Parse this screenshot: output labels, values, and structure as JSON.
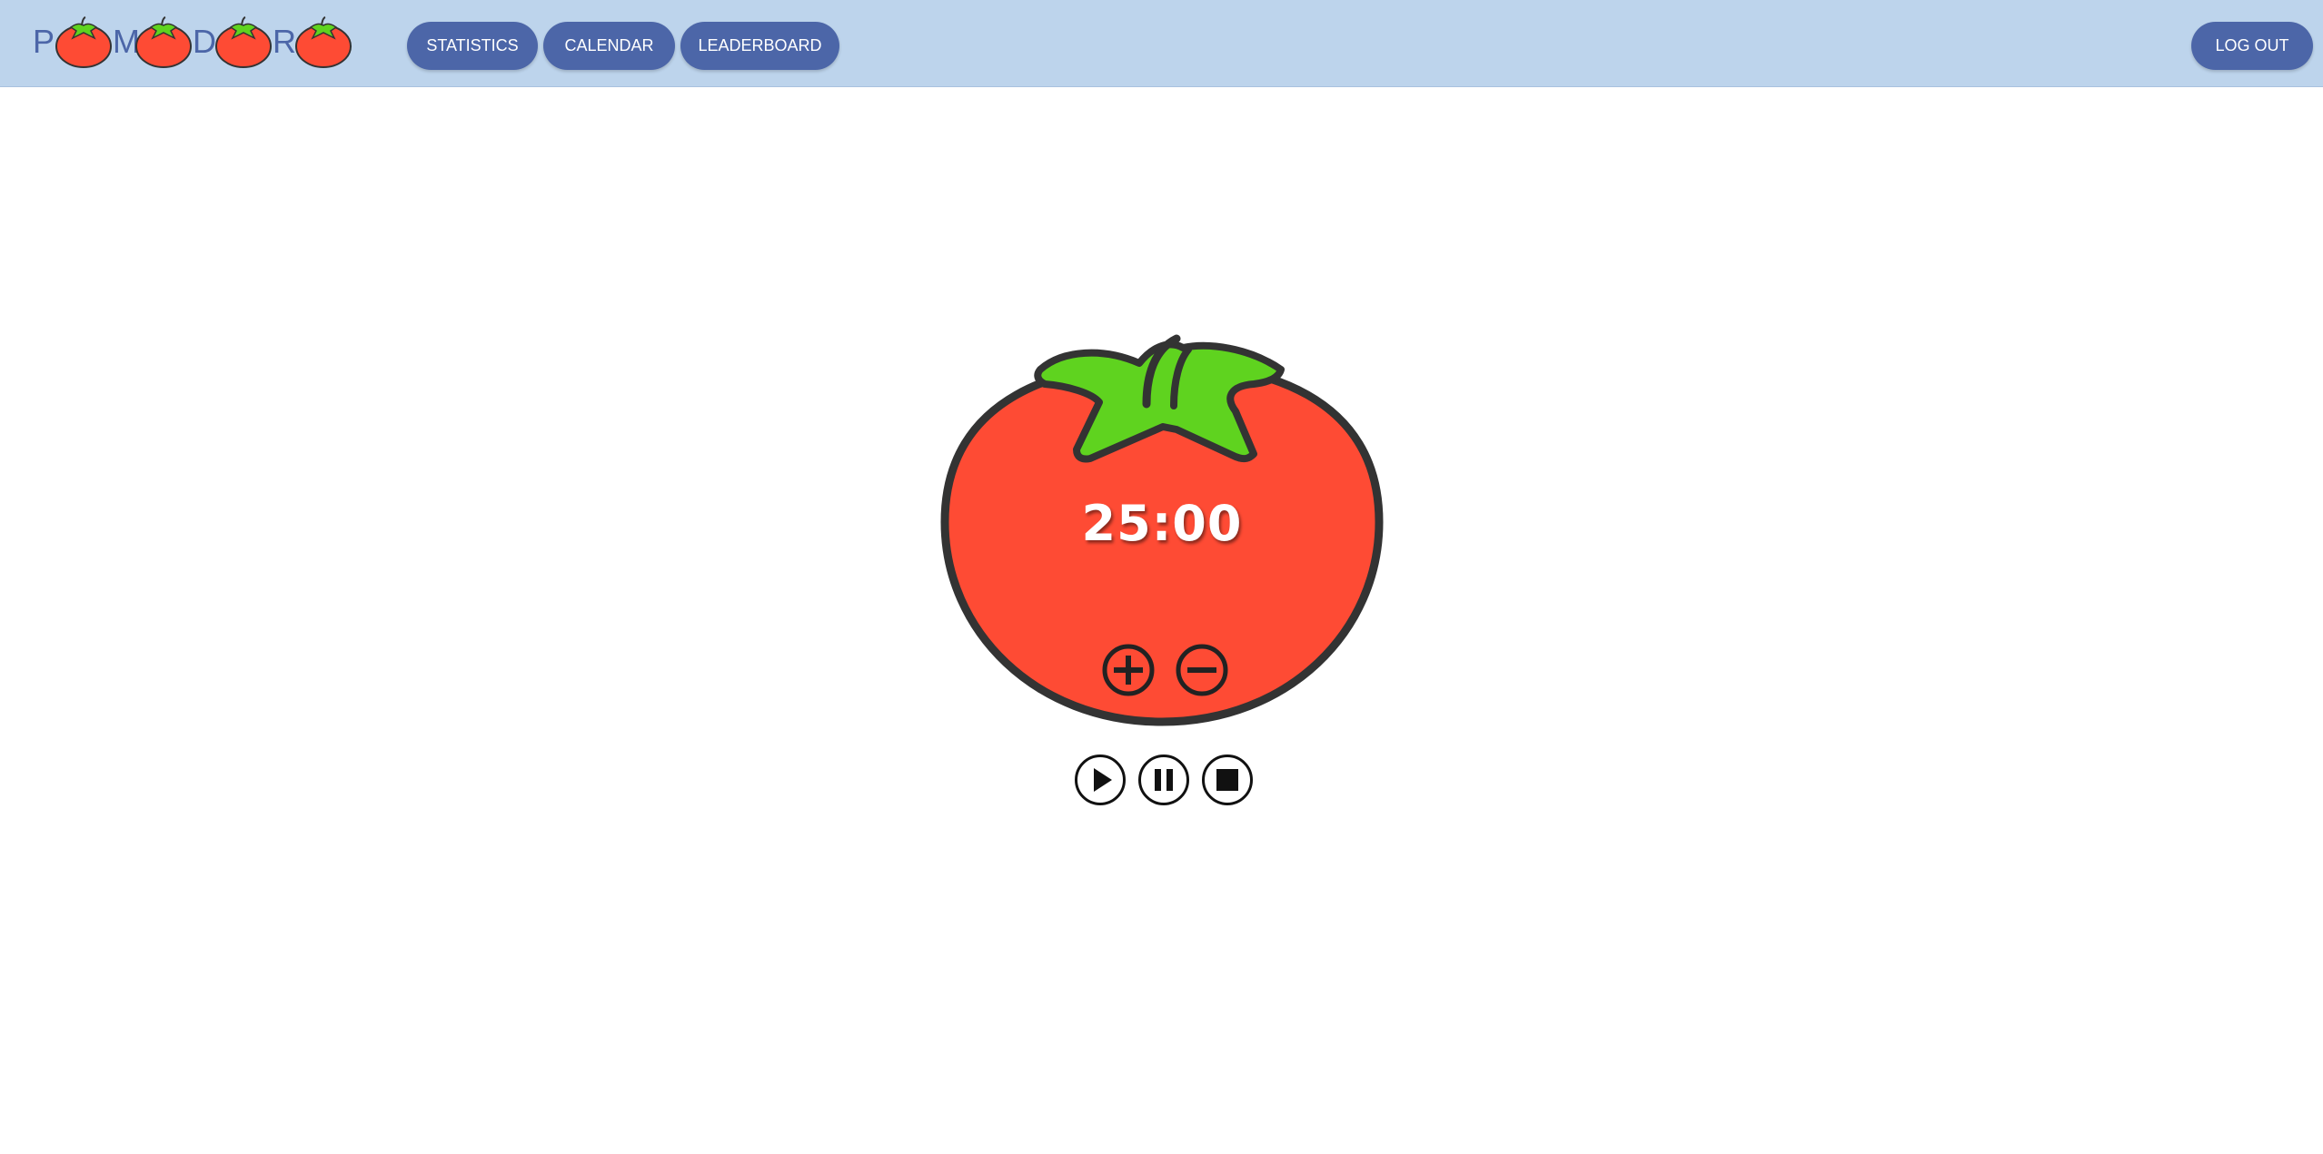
{
  "app": {
    "logo_letters": [
      "P",
      "M",
      "D",
      "R"
    ],
    "logo_text": "POMODORO"
  },
  "nav": {
    "statistics_label": "STATISTICS",
    "calendar_label": "CALENDAR",
    "leaderboard_label": "LEADERBOARD",
    "logout_label": "LOG OUT"
  },
  "timer": {
    "display": "25:00"
  },
  "controls": {
    "increase_icon": "plus-circle-icon",
    "decrease_icon": "minus-circle-icon",
    "play_icon": "play-icon",
    "pause_icon": "pause-icon",
    "stop_icon": "stop-icon"
  },
  "colors": {
    "header_bg": "#bdd4ec",
    "button_bg": "#4c66a8",
    "tomato_red": "#fe4b34",
    "leaf_green": "#5fd31f",
    "outline": "#333333"
  }
}
